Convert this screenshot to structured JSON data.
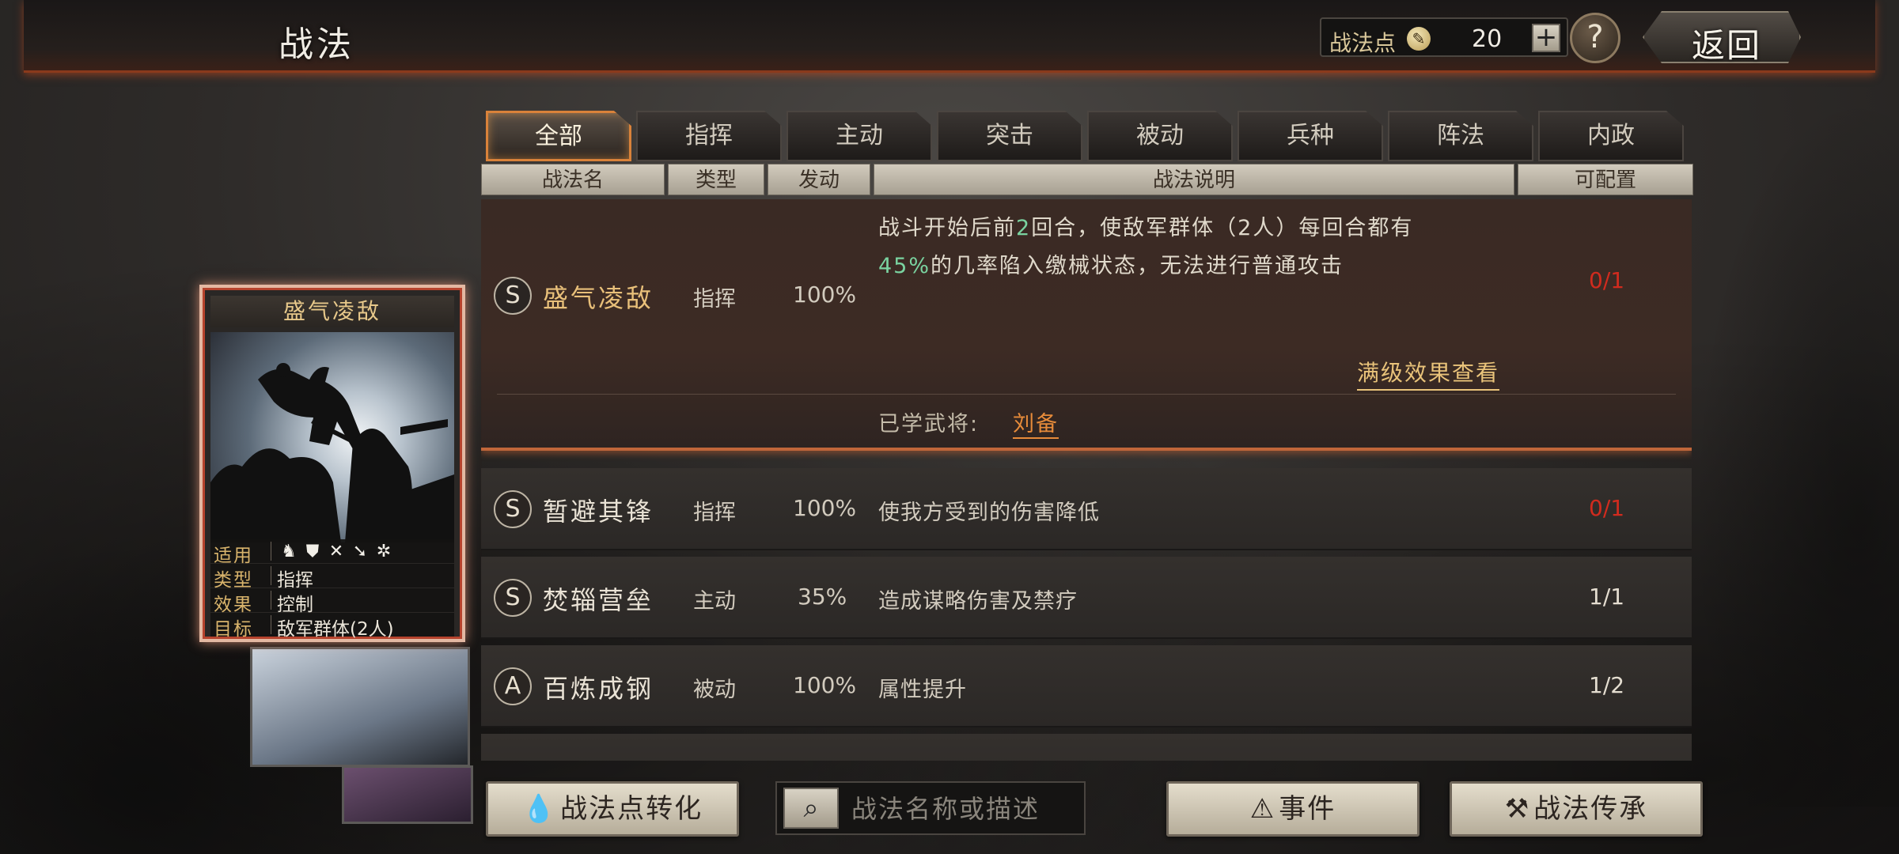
{
  "header": {
    "title": "战法",
    "points_label": "战法点",
    "points_value": "20",
    "plus_label": "+",
    "help_label": "?",
    "back_label": "返回"
  },
  "tabs": [
    {
      "label": "全部",
      "active": true
    },
    {
      "label": "指挥",
      "active": false
    },
    {
      "label": "主动",
      "active": false
    },
    {
      "label": "突击",
      "active": false
    },
    {
      "label": "被动",
      "active": false
    },
    {
      "label": "兵种",
      "active": false
    },
    {
      "label": "阵法",
      "active": false
    },
    {
      "label": "内政",
      "active": false
    }
  ],
  "columns": {
    "name": "战法名",
    "type": "类型",
    "trigger": "发动",
    "desc": "战法说明",
    "config": "可配置"
  },
  "expanded": {
    "grade": "S",
    "name": "盛气凌敌",
    "type": "指挥",
    "rate": "100%",
    "desc_line1_a": "战斗开始后前",
    "desc_line1_num": "2",
    "desc_line1_b": "回合，使敌军群体（2人）每回合都有",
    "desc_line2_num": "45%",
    "desc_line2_b": "的几率陷入缴械状态，无法进行普通攻击",
    "count": "0/1",
    "max_link": "满级效果查看",
    "learned_label": "已学武将:",
    "learned_name": "刘备"
  },
  "rows": [
    {
      "grade": "S",
      "name": "暂避其锋",
      "type": "指挥",
      "rate": "100%",
      "desc": "使我方受到的伤害降低",
      "count": "0/1",
      "count_red": true
    },
    {
      "grade": "S",
      "name": "焚辎营垒",
      "type": "主动",
      "rate": "35%",
      "desc": "造成谋略伤害及禁疗",
      "count": "1/1",
      "count_red": false
    },
    {
      "grade": "A",
      "name": "百炼成钢",
      "type": "被动",
      "rate": "100%",
      "desc": "属性提升",
      "count": "1/2",
      "count_red": false
    }
  ],
  "card": {
    "title": "盛气凌敌",
    "apply_key": "适用",
    "type_key": "类型",
    "type_val": "指挥",
    "effect_key": "效果",
    "effect_val": "控制",
    "target_key": "目标",
    "target_val": "敌军群体(2人)",
    "unit_icons": [
      "cavalry-icon",
      "shield-icon",
      "bow-icon",
      "spear-icon",
      "wheel-icon"
    ]
  },
  "bottom": {
    "convert_label": "战法点转化",
    "search_placeholder": "战法名称或描述",
    "event_label": "事件",
    "inherit_label": "战法传承"
  },
  "colors": {
    "accent_orange": "#d9823a",
    "highlight_green": "#7ad3a0",
    "count_red": "#d12b1e",
    "gold_text": "#e9c07a"
  }
}
